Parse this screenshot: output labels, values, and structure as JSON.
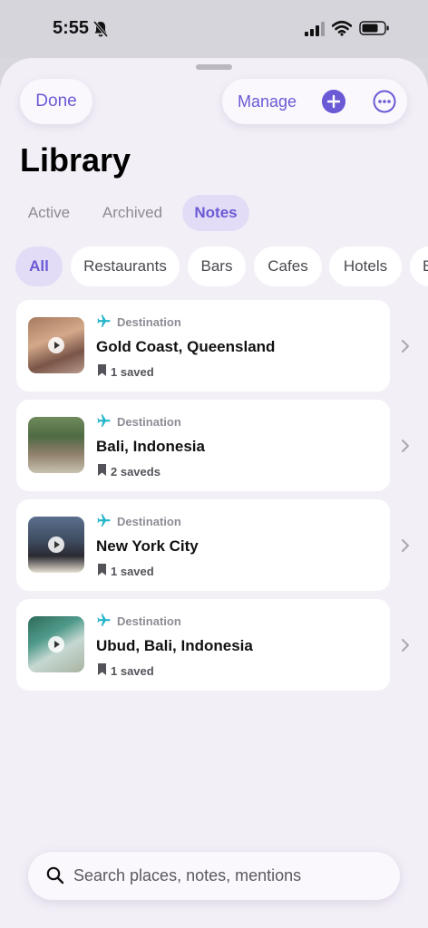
{
  "status_bar": {
    "time": "5:55"
  },
  "header": {
    "done_label": "Done",
    "manage_label": "Manage",
    "title": "Library"
  },
  "segments": [
    {
      "label": "Active",
      "selected": false
    },
    {
      "label": "Archived",
      "selected": false
    },
    {
      "label": "Notes",
      "selected": true
    }
  ],
  "filters": [
    {
      "label": "All",
      "selected": true
    },
    {
      "label": "Restaurants",
      "selected": false
    },
    {
      "label": "Bars",
      "selected": false
    },
    {
      "label": "Cafes",
      "selected": false
    },
    {
      "label": "Hotels",
      "selected": false
    },
    {
      "label": "B",
      "selected": false
    }
  ],
  "items": [
    {
      "category": "Destination",
      "title": "Gold Coast, Queensland",
      "saved": "1 saved",
      "thumb_icon": "video-thumbnail"
    },
    {
      "category": "Destination",
      "title": "Bali, Indonesia",
      "saved": "2 saveds",
      "thumb_icon": "photo-thumbnail"
    },
    {
      "category": "Destination",
      "title": "New York City",
      "saved": "1 saved",
      "thumb_icon": "video-thumbnail"
    },
    {
      "category": "Destination",
      "title": "Ubud, Bali, Indonesia",
      "saved": "1 saved",
      "thumb_icon": "video-thumbnail"
    }
  ],
  "search": {
    "placeholder": "Search places, notes, mentions"
  },
  "colors": {
    "accent": "#6b5ad6",
    "category_icon": "#24b6c9",
    "sheet_background": "#f3eff7",
    "chip_selected": "#e3dcf6"
  }
}
